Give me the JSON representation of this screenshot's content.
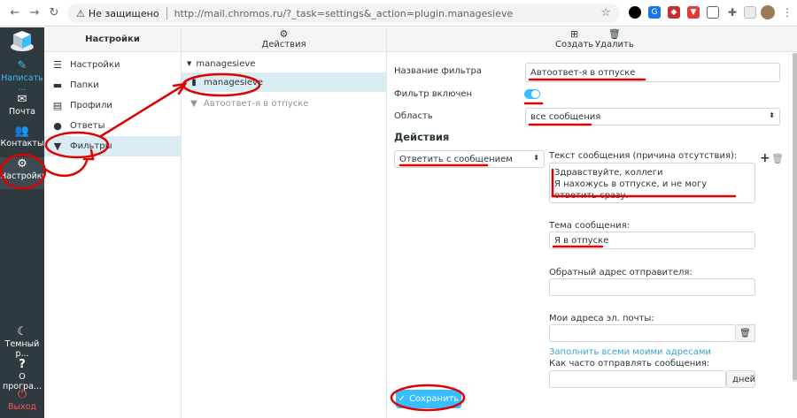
{
  "browser": {
    "security_label": "Не защищено",
    "url": "http://mail.chromos.ru/?_task=settings&_action=plugin.managesieve"
  },
  "rail": {
    "compose": "Написать ...",
    "mail": "Почта",
    "contacts": "Контакты",
    "settings": "Настройки",
    "dark_mode": "Темный р...",
    "about": "О програ...",
    "logout": "Выход"
  },
  "settings_column": {
    "title": "Настройки",
    "items": [
      {
        "label": "Настройки",
        "icon": "sliders-icon"
      },
      {
        "label": "Папки",
        "icon": "folder-icon"
      },
      {
        "label": "Профили",
        "icon": "id-card-icon"
      },
      {
        "label": "Ответы",
        "icon": "comment-icon"
      },
      {
        "label": "Фильтры",
        "icon": "filter-icon"
      }
    ]
  },
  "filters_column": {
    "actions_label": "Действия",
    "filterset_name": "managesieve",
    "selected_set": "managesieve",
    "filter_item": "Автоответ-я в отпуске"
  },
  "toolbar": {
    "create_label": "Создать",
    "delete_label": "Удалить"
  },
  "form": {
    "name_label": "Название фильтра",
    "name_value": "Автоответ-я в отпуске",
    "enabled_label": "Фильтр включен",
    "enabled": true,
    "scope_label": "Область",
    "scope_value": "все сообщения",
    "actions_title": "Действия",
    "action_value": "Ответить с сообщением",
    "body_label": "Текст сообщения (причина отсутствия):",
    "body_line1": "Здравствуйте, коллеги",
    "body_line2": "Я нахожусь в отпуске, и не могу ответить сразу.",
    "subject_label": "Тема сообщения:",
    "subject_value": "Я в отпуске",
    "return_label": "Обратный адрес отправителя:",
    "return_value": "",
    "my_addresses_label": "Мои адреса эл. почты:",
    "my_addresses_value": "",
    "fill_link": "Заполнить всеми моими адресами",
    "frequency_label": "Как часто отправлять сообщения:",
    "frequency_unit": "дней",
    "save_label": "Сохранить"
  },
  "colors": {
    "accent": "#37beff",
    "rail_bg": "#2f3a3f",
    "annotation": "#e00000"
  }
}
